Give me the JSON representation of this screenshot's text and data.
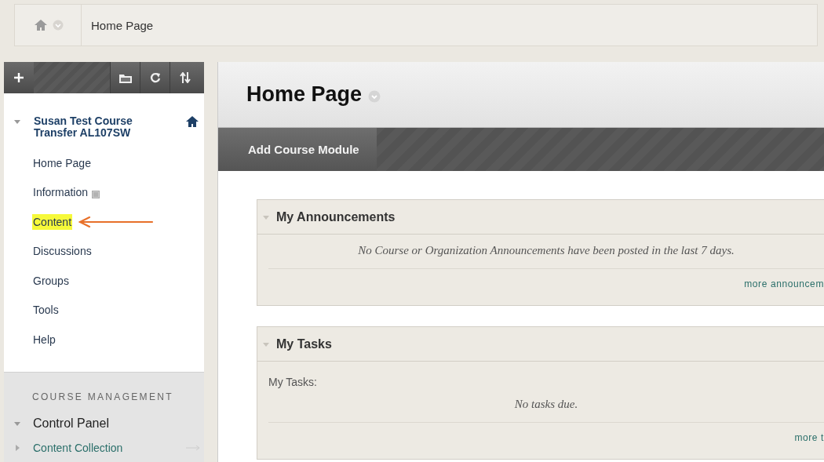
{
  "breadcrumb": {
    "label": "Home Page"
  },
  "sidebar": {
    "course": {
      "title": "Susan Test Course Transfer AL107SW",
      "expanded": true
    },
    "items": [
      {
        "label": "Home Page",
        "highlighted": false,
        "badge": false
      },
      {
        "label": "Information",
        "highlighted": false,
        "badge": true
      },
      {
        "label": "Content",
        "highlighted": true,
        "badge": false
      },
      {
        "label": "Discussions",
        "highlighted": false,
        "badge": false
      },
      {
        "label": "Groups",
        "highlighted": false,
        "badge": false
      },
      {
        "label": "Tools",
        "highlighted": false,
        "badge": false
      },
      {
        "label": "Help",
        "highlighted": false,
        "badge": false
      }
    ],
    "management": {
      "heading": "COURSE MANAGEMENT",
      "panel": {
        "label": "Control Panel",
        "expanded": true
      },
      "items": [
        {
          "label": "Content Collection",
          "expanded": false
        }
      ]
    }
  },
  "page": {
    "title": "Home Page",
    "action": "Add Course Module",
    "modules": [
      {
        "title": "My Announcements",
        "expanded": true,
        "message": "No Course or Organization Announcements have been posted in the last 7 days.",
        "link": "more announcem"
      },
      {
        "title": "My Tasks",
        "expanded": true,
        "intro": "My Tasks:",
        "message": "No tasks due.",
        "link": "more t"
      }
    ]
  }
}
